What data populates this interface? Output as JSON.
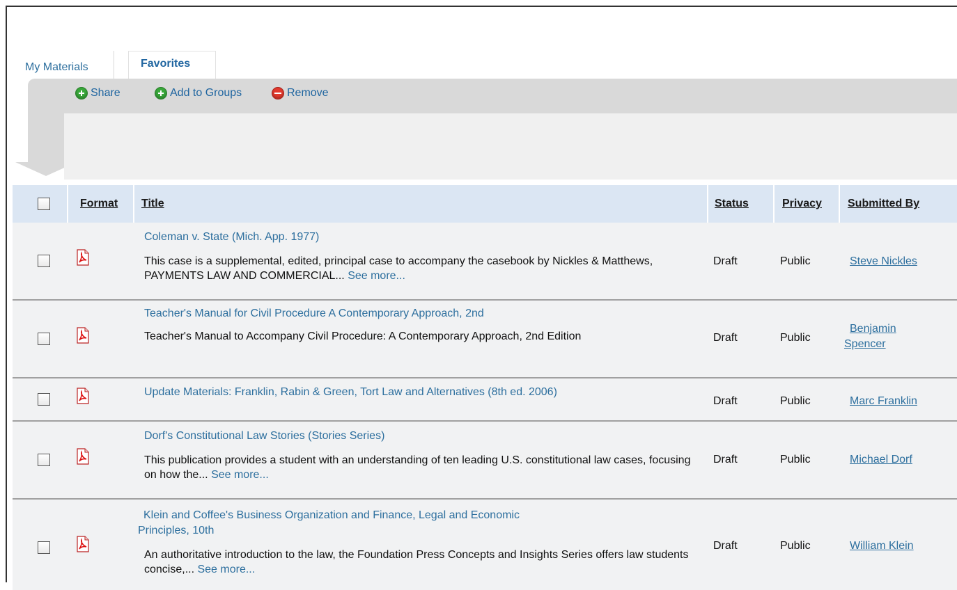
{
  "tabs": [
    {
      "label": "My Materials",
      "active": false
    },
    {
      "label": "Favorites",
      "active": true
    }
  ],
  "toolbar": {
    "share_label": "Share",
    "add_groups_label": "Add to Groups",
    "remove_label": "Remove"
  },
  "table": {
    "columns": {
      "format": "Format",
      "title": "Title",
      "status": "Status",
      "privacy": "Privacy",
      "submitted_by": "Submitted By"
    },
    "rows": [
      {
        "title": "Coleman v. State (Mich. App. 1977)",
        "description": "This case is a supplemental, edited, principal case to accompany the casebook by Nickles & Matthews, PAYMENTS LAW AND COMMERCIAL... ",
        "see_more": "See more...",
        "status": "Draft",
        "privacy": "Public",
        "submitted_by": "Steve Nickles"
      },
      {
        "title": "Teacher's Manual for Civil Procedure A Contemporary Approach, 2nd",
        "description": "Teacher's Manual to Accompany Civil Procedure: A Contemporary Approach, 2nd Edition",
        "see_more": "",
        "status": "Draft",
        "privacy": "Public",
        "submitted_by_line1": "Benjamin",
        "submitted_by_line2": "Spencer"
      },
      {
        "title": "Update Materials: Franklin, Rabin & Green, Tort Law and Alternatives (8th ed. 2006)",
        "status": "Draft",
        "privacy": "Public",
        "submitted_by": "Marc Franklin"
      },
      {
        "title": "Dorf's Constitutional Law Stories (Stories Series)",
        "description": "This publication provides a student with an understanding of ten leading U.S. constitutional law cases, focusing on how the... ",
        "see_more": "See more...",
        "status": "Draft",
        "privacy": "Public",
        "submitted_by": "Michael Dorf"
      },
      {
        "title_line1": "Klein and Coffee's Business Organization and Finance, Legal and Economic",
        "title_line2": "Principles, 10th",
        "description": "An authoritative introduction to the law, the Foundation Press Concepts and Insights Series offers law students concise,... ",
        "see_more": "See more...",
        "status": "Draft",
        "privacy": "Public",
        "submitted_by": "William Klein"
      }
    ]
  },
  "colors": {
    "link": "#2d6f9e",
    "header_bg": "#dbe6f3",
    "row_bg": "#f1f2f3",
    "toolbar_bg": "#d9d9d9"
  },
  "icons": {
    "share": "plus-circle-icon",
    "add_groups": "plus-circle-icon",
    "remove": "minus-circle-icon",
    "format": "pdf-icon"
  }
}
